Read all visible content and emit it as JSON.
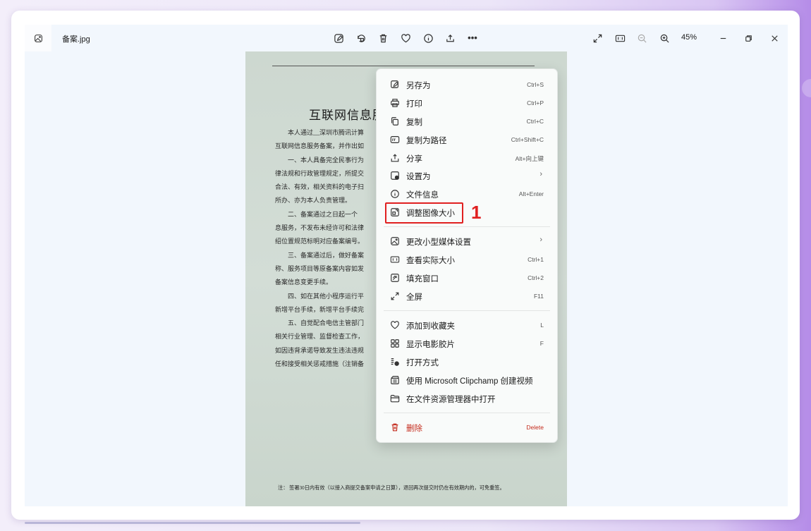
{
  "window": {
    "filename": "备案.jpg",
    "zoom": "45%"
  },
  "toolbar_icons": [
    "edit-icon",
    "rotate-icon",
    "delete-icon",
    "favorite-icon",
    "info-icon",
    "share-icon",
    "more-icon"
  ],
  "document": {
    "title": "互联网信息服",
    "lines": [
      "　　本人通过__深圳市腾讯计算",
      "互联网信息服务备案，并作出如",
      "　　一、本人具备完全民事行为",
      "律法规和行政管理规定，所提交",
      "合法、有效，相关资料的电子扫",
      "所办、亦为本人负责管理。",
      "　　二、备案通过之日起一个",
      "息服务，不发布未经许可和法律",
      "绍位置规范标明对应备案编号。",
      "　　三、备案通过后，做好备案",
      "称、服务项目等原备案内容如发",
      "备案信息变更手续。",
      "　　四、如在其他小程序运行平",
      "新增平台手续，新增平台手续完",
      "　　五、自觉配合电信主管部门",
      "相关行业管理、监督检查工作，",
      "如因违背承诺导致发生违法违规",
      "任和接受相关惩戒措施（注销备"
    ],
    "note": "注：  签署30日内有效（以接入商提交备案申请之日算），退回再次提交时仍在有效期内的，可免重签。"
  },
  "menu": {
    "items": [
      {
        "label": "另存为",
        "shortcut": "Ctrl+S"
      },
      {
        "label": "打印",
        "shortcut": "Ctrl+P"
      },
      {
        "label": "复制",
        "shortcut": "Ctrl+C"
      },
      {
        "label": "复制为路径",
        "shortcut": "Ctrl+Shift+C"
      },
      {
        "label": "分享",
        "shortcut": "Alt+向上键"
      },
      {
        "label": "设置为",
        "shortcut": "›"
      },
      {
        "label": "文件信息",
        "shortcut": "Alt+Enter"
      },
      {
        "label": "调整图像大小",
        "shortcut": ""
      },
      {
        "label": "更改小型媒体设置",
        "shortcut": "›"
      },
      {
        "label": "查看实际大小",
        "shortcut": "Ctrl+1"
      },
      {
        "label": "填充窗口",
        "shortcut": "Ctrl+2"
      },
      {
        "label": "全屏",
        "shortcut": "F11"
      },
      {
        "label": "添加到收藏夹",
        "shortcut": "L"
      },
      {
        "label": "显示电影胶片",
        "shortcut": "F"
      },
      {
        "label": "打开方式",
        "shortcut": ""
      },
      {
        "label": "使用 Microsoft Clipchamp 创建视频",
        "shortcut": ""
      },
      {
        "label": "在文件资源管理器中打开",
        "shortcut": ""
      },
      {
        "label": "删除",
        "shortcut": "Delete"
      }
    ]
  },
  "annotation": {
    "number": "1"
  },
  "colors": {
    "accent_red": "#e02020",
    "danger": "#c42b1c"
  }
}
